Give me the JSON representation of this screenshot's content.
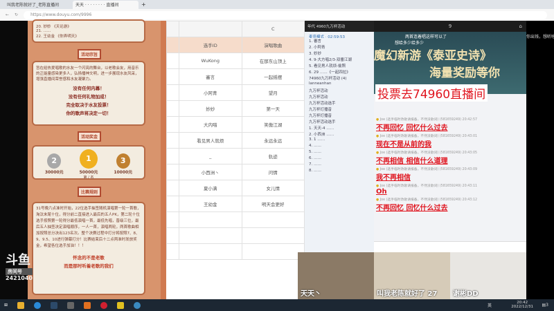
{
  "browser": {
    "tabs": [
      "叫我老陈就好了_老陈直播间",
      "天天 · · · · · · · · 直播间"
    ],
    "url": "https://www.douyu.com/9996"
  },
  "overlay": {
    "logo": "斗鱼",
    "room_label": "房间号",
    "room_id": "2421040"
  },
  "poster": {
    "list": [
      "20. 妙妙 《天论游》",
      "21. ……",
      "22. 王幼金 《你弄明天》"
    ],
    "purpose_tag": "活动宗旨",
    "purpose_text": "旨在给热爱唱歌的水友一个闪亮的舞台，以老歌会友，用音乐的正能量感染更多人，弘扬播神文明，进一步展现水友风采，增强直播间荣誉感和水友凝聚力。",
    "quotes": [
      "没有任何内幕！",
      "没有任何礼物加成！",
      "完全取决于水友投票！",
      "你的歌声将决定一切！"
    ],
    "prize_tag": "活动奖金",
    "prizes": [
      {
        "rank": "2",
        "amount": "30000元"
      },
      {
        "rank": "1",
        "amount": "50000元"
      },
      {
        "rank": "3",
        "amount": "10000元"
      }
    ],
    "rank_prefix": "第",
    "rank_suffix": "名",
    "rules_tag": "比赛规则",
    "rules_text": "31号晚六点准时开始，22位选手抽签随机演唱第一轮一首歌，淘汰末尾十位，得分前二直接进入最后的五人PK，第二轮十位选手按照第一轮得分最低演唱一首，最低先唱，晋级三位，最后五人抽签决定演唱顺序，一人一首，演唱两轮，两首歌曲相加按照总分决出123名次。整个决赛过程中打分将按照7、8、9、9.5、10进行弹幕打分！比赛结束后十二点两准时发放奖金，希望各位选手加油！！！",
    "slogan": [
      "怀念的不是老歌",
      "而是那时听着老歌的我们"
    ]
  },
  "sheet": {
    "col": "C",
    "headers": [
      "选手ID",
      "演唱歌曲"
    ],
    "rows": [
      [
        "WuKong",
        "在那东山顶上"
      ],
      [
        "審言",
        "一起摇摆"
      ],
      [
        "小阿青",
        "望月"
      ],
      [
        "妙妙",
        "第一天"
      ],
      [
        "大内喵",
        "笑傲江湖"
      ],
      [
        "看见男人就烦",
        "永远永远"
      ],
      [
        "_",
        "轨迹"
      ],
      [
        "小西洲丶",
        "问情"
      ],
      [
        "夏小满",
        "女儿情"
      ],
      [
        "王幼金",
        "明天会更好"
      ]
    ]
  },
  "chatlist": {
    "title": "年代 4960九万杯活动",
    "mode": "麦序模式 · 02:59:53",
    "rows": [
      "1. 審言",
      "2. 小阿青",
      "3. 妙妙",
      "4. 9-大方唱2/3-双番江湖",
      "5. 看见男人就烦-偷照",
      "6. 29 ……《一起四拉》",
      "74960九万杯活动 (4)",
      "lanneanhan",
      "九万杯活动",
      "九万杯活动",
      "九万杯活动选手",
      "九万杯灯播音",
      "九万杯灯播音",
      "九万杯活动选手",
      "1. 天天-4 ……",
      "2. 小西洲 ……",
      "3. 1 ……",
      "4. ……",
      "5. ……",
      "6. ……",
      "7. ……",
      "8. ……"
    ]
  },
  "stream": {
    "top_count": "9",
    "danmaku": [
      "两首连着唱这样可以了",
      "你出钱，想听啥听",
      "想给多少给多少"
    ],
    "banner": [
      "魔幻新游《泰亚史诗》",
      "海量奖励等你"
    ],
    "vote": "投票去74960直播间",
    "messages": [
      {
        "user": "Joe",
        "meta": "(选手临时改歌请报备，不然没歌词) (581659249) 20:42:57",
        "text": "不再回忆 回忆什么过去"
      },
      {
        "user": "Joe",
        "meta": "(选手临时改歌请报备，不然没歌词) (581659249) 20:43:01",
        "text": "现在不是从前的我"
      },
      {
        "user": "Joe",
        "meta": "(选手临时改歌请报备，不然没歌词) (581659249) 20:43:05",
        "text": "不再相信 相信什么道理"
      },
      {
        "user": "Joe",
        "meta": "(选手临时改歌请报备，不然没歌词) (581659249) 20:43:09",
        "text": "我不再相信"
      },
      {
        "user": "Joe",
        "meta": "(选手临时改歌请报备，不然没歌词) (581659249) 20:43:11",
        "text": "Oh"
      },
      {
        "user": "Joe",
        "meta": "(选手临时改歌请报备，不然没歌词) (581659249) 20:43:12",
        "text": "不再回忆 回忆什么过去"
      }
    ]
  },
  "cams": [
    "天天丶",
    "叫我老陈就好了 27",
    "谢彬DD"
  ],
  "taskbar": {
    "ime": "英",
    "time": "20:42",
    "date": "2022/12/31",
    "notif": "3"
  }
}
